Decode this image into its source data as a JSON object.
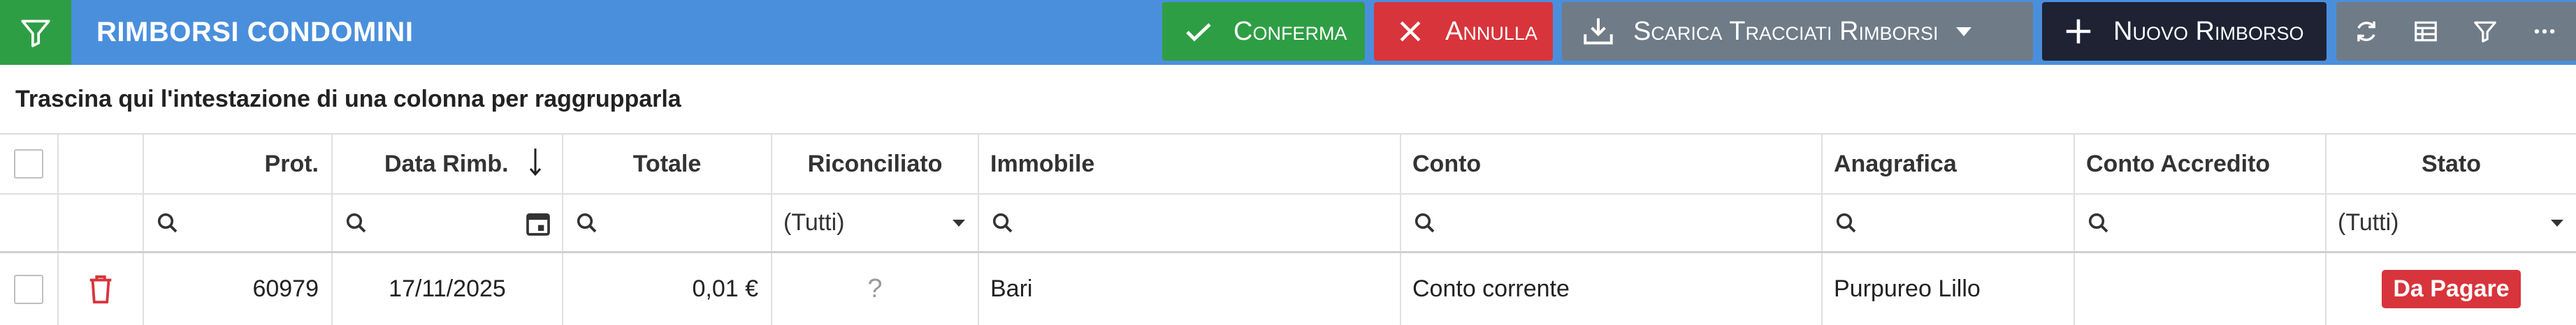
{
  "colors": {
    "toolbar_bg": "#4a8fdc",
    "confirm": "#2e9e44",
    "cancel": "#d8343b",
    "download": "#6f7b87",
    "new": "#1e2233",
    "badge": "#d8343b"
  },
  "toolbar": {
    "filter_icon": "filter-icon",
    "title": "RIMBORSI CONDOMINI",
    "confirm_label": "Conferma",
    "cancel_label": "Annulla",
    "download_label": "Scarica Tracciati Rimborsi",
    "new_label": "Nuovo Rimborso",
    "right_icons": [
      "refresh-icon",
      "table-icon",
      "filter-icon",
      "more-icon"
    ]
  },
  "group_panel": {
    "text": "Trascina qui l'intestazione di una colonna per raggrupparla"
  },
  "grid": {
    "columns": [
      "",
      "",
      "Prot.",
      "Data Rimb.",
      "Totale",
      "Riconciliato",
      "Immobile",
      "Conto",
      "Anagrafica",
      "Conto Accredito",
      "Stato"
    ],
    "filters": {
      "riconciliato": "(Tutti)",
      "stato": "(Tutti)"
    },
    "rows": [
      {
        "prot": "60979",
        "data_rimb": "17/11/2025",
        "totale": "0,01 €",
        "riconciliato": "?",
        "immobile": "Bari",
        "conto": "Conto corrente",
        "anagrafica": "Purpureo Lillo",
        "conto_accredito": "",
        "stato": "Da Pagare"
      }
    ]
  }
}
